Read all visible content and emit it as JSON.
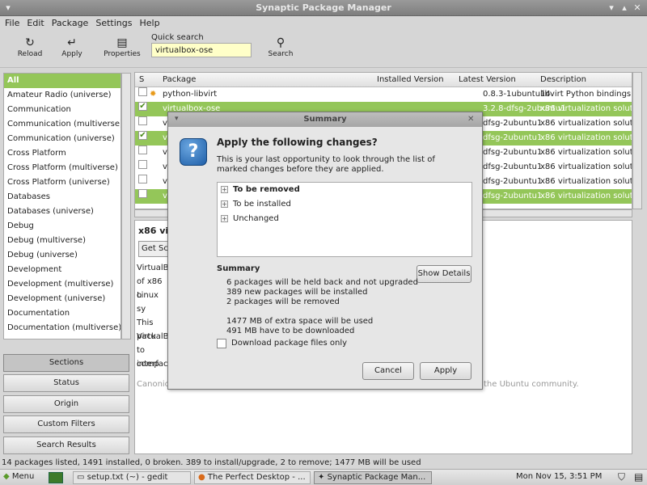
{
  "window": {
    "title": "Synaptic Package Manager"
  },
  "menu": [
    "File",
    "Edit",
    "Package",
    "Settings",
    "Help"
  ],
  "toolbar": {
    "reload": {
      "label": "Reload",
      "icon": "reload-icon"
    },
    "apply": {
      "label": "Apply",
      "icon": "apply-icon"
    },
    "properties": {
      "label": "Properties",
      "icon": "properties-icon"
    },
    "quick_search_label": "Quick search",
    "quick_search_value": "virtualbox-ose",
    "search": {
      "label": "Search",
      "icon": "search-icon"
    }
  },
  "sidebar": {
    "items": [
      "All",
      "Amateur Radio (universe)",
      "Communication",
      "Communication (multiverse)",
      "Communication (universe)",
      "Cross Platform",
      "Cross Platform (multiverse)",
      "Cross Platform (universe)",
      "Databases",
      "Databases (universe)",
      "Debug",
      "Debug (multiverse)",
      "Debug (universe)",
      "Development",
      "Development (multiverse)",
      "Development (universe)",
      "Documentation",
      "Documentation (multiverse)"
    ],
    "buttons": [
      "Sections",
      "Status",
      "Origin",
      "Custom Filters",
      "Search Results"
    ]
  },
  "packages": {
    "headers": [
      "S",
      "Package",
      "Installed Version",
      "Latest Version",
      "Description"
    ],
    "rows": [
      {
        "name": "python-libvirt",
        "installed": "",
        "latest": "0.8.3-1ubuntu14",
        "desc": "libvirt Python bindings"
      },
      {
        "name": "virtualbox-ose",
        "installed": "",
        "latest": "3.2.8-dfsg-2ubuntu1",
        "desc": "x86 virtualization solutic"
      },
      {
        "name": "vi",
        "installed": "",
        "latest": "dfsg-2ubuntu1",
        "desc": "x86 virtualization solutic"
      },
      {
        "name": "vi",
        "installed": "",
        "latest": "dfsg-2ubuntu1",
        "desc": "x86 virtualization solutic"
      },
      {
        "name": "vi",
        "installed": "",
        "latest": "dfsg-2ubuntu1",
        "desc": "x86 virtualization solutic"
      },
      {
        "name": "vi",
        "installed": "",
        "latest": "dfsg-2ubuntu1",
        "desc": "x86 virtualization solutic"
      },
      {
        "name": "vi",
        "installed": "",
        "latest": "dfsg-2ubuntu1",
        "desc": "x86 virtualization solutic"
      },
      {
        "name": "vi",
        "installed": "",
        "latest": "dfsg-2ubuntu1",
        "desc": "x86 virtualization solutic"
      }
    ]
  },
  "description": {
    "title": "x86 vi",
    "get_screenshot": "Get Scr",
    "lines": [
      "VirtualBo",
      "of x86 o",
      "Linux sy",
      "",
      "This pack",
      "VirtualBo",
      "to comp",
      "interfac"
    ],
    "footer_left": "Canonic",
    "footer_right": "the Ubuntu community."
  },
  "dialog": {
    "title": "Summary",
    "heading": "Apply the following changes?",
    "intro": "This is your last opportunity to look through the list of marked changes before they are applied.",
    "changes": [
      {
        "label": "To be removed",
        "bold": true
      },
      {
        "label": "To be installed",
        "bold": false
      },
      {
        "label": "Unchanged",
        "bold": false
      }
    ],
    "summary_heading": "Summary",
    "show_details": "Show Details",
    "summary_lines": [
      "6 packages will be held back and not upgraded",
      "389 new packages will be installed",
      "2 packages will be removed",
      "",
      "1477 MB of extra space will be used",
      "491 MB have to be downloaded"
    ],
    "download_only_label": "Download package files only",
    "cancel": "Cancel",
    "apply": "Apply"
  },
  "status": "14 packages listed, 1491 installed, 0 broken. 389 to install/upgrade, 2 to remove; 1477 MB will be used",
  "taskbar": {
    "menu": "Menu",
    "tasks": [
      "setup.txt (~) - gedit",
      "The Perfect Desktop - ...",
      "Synaptic Package Man..."
    ],
    "clock": "Mon Nov 15,  3:51 PM"
  },
  "colors": {
    "selection_green": "#94c659",
    "quick_search_bg": "#ffffc8"
  }
}
